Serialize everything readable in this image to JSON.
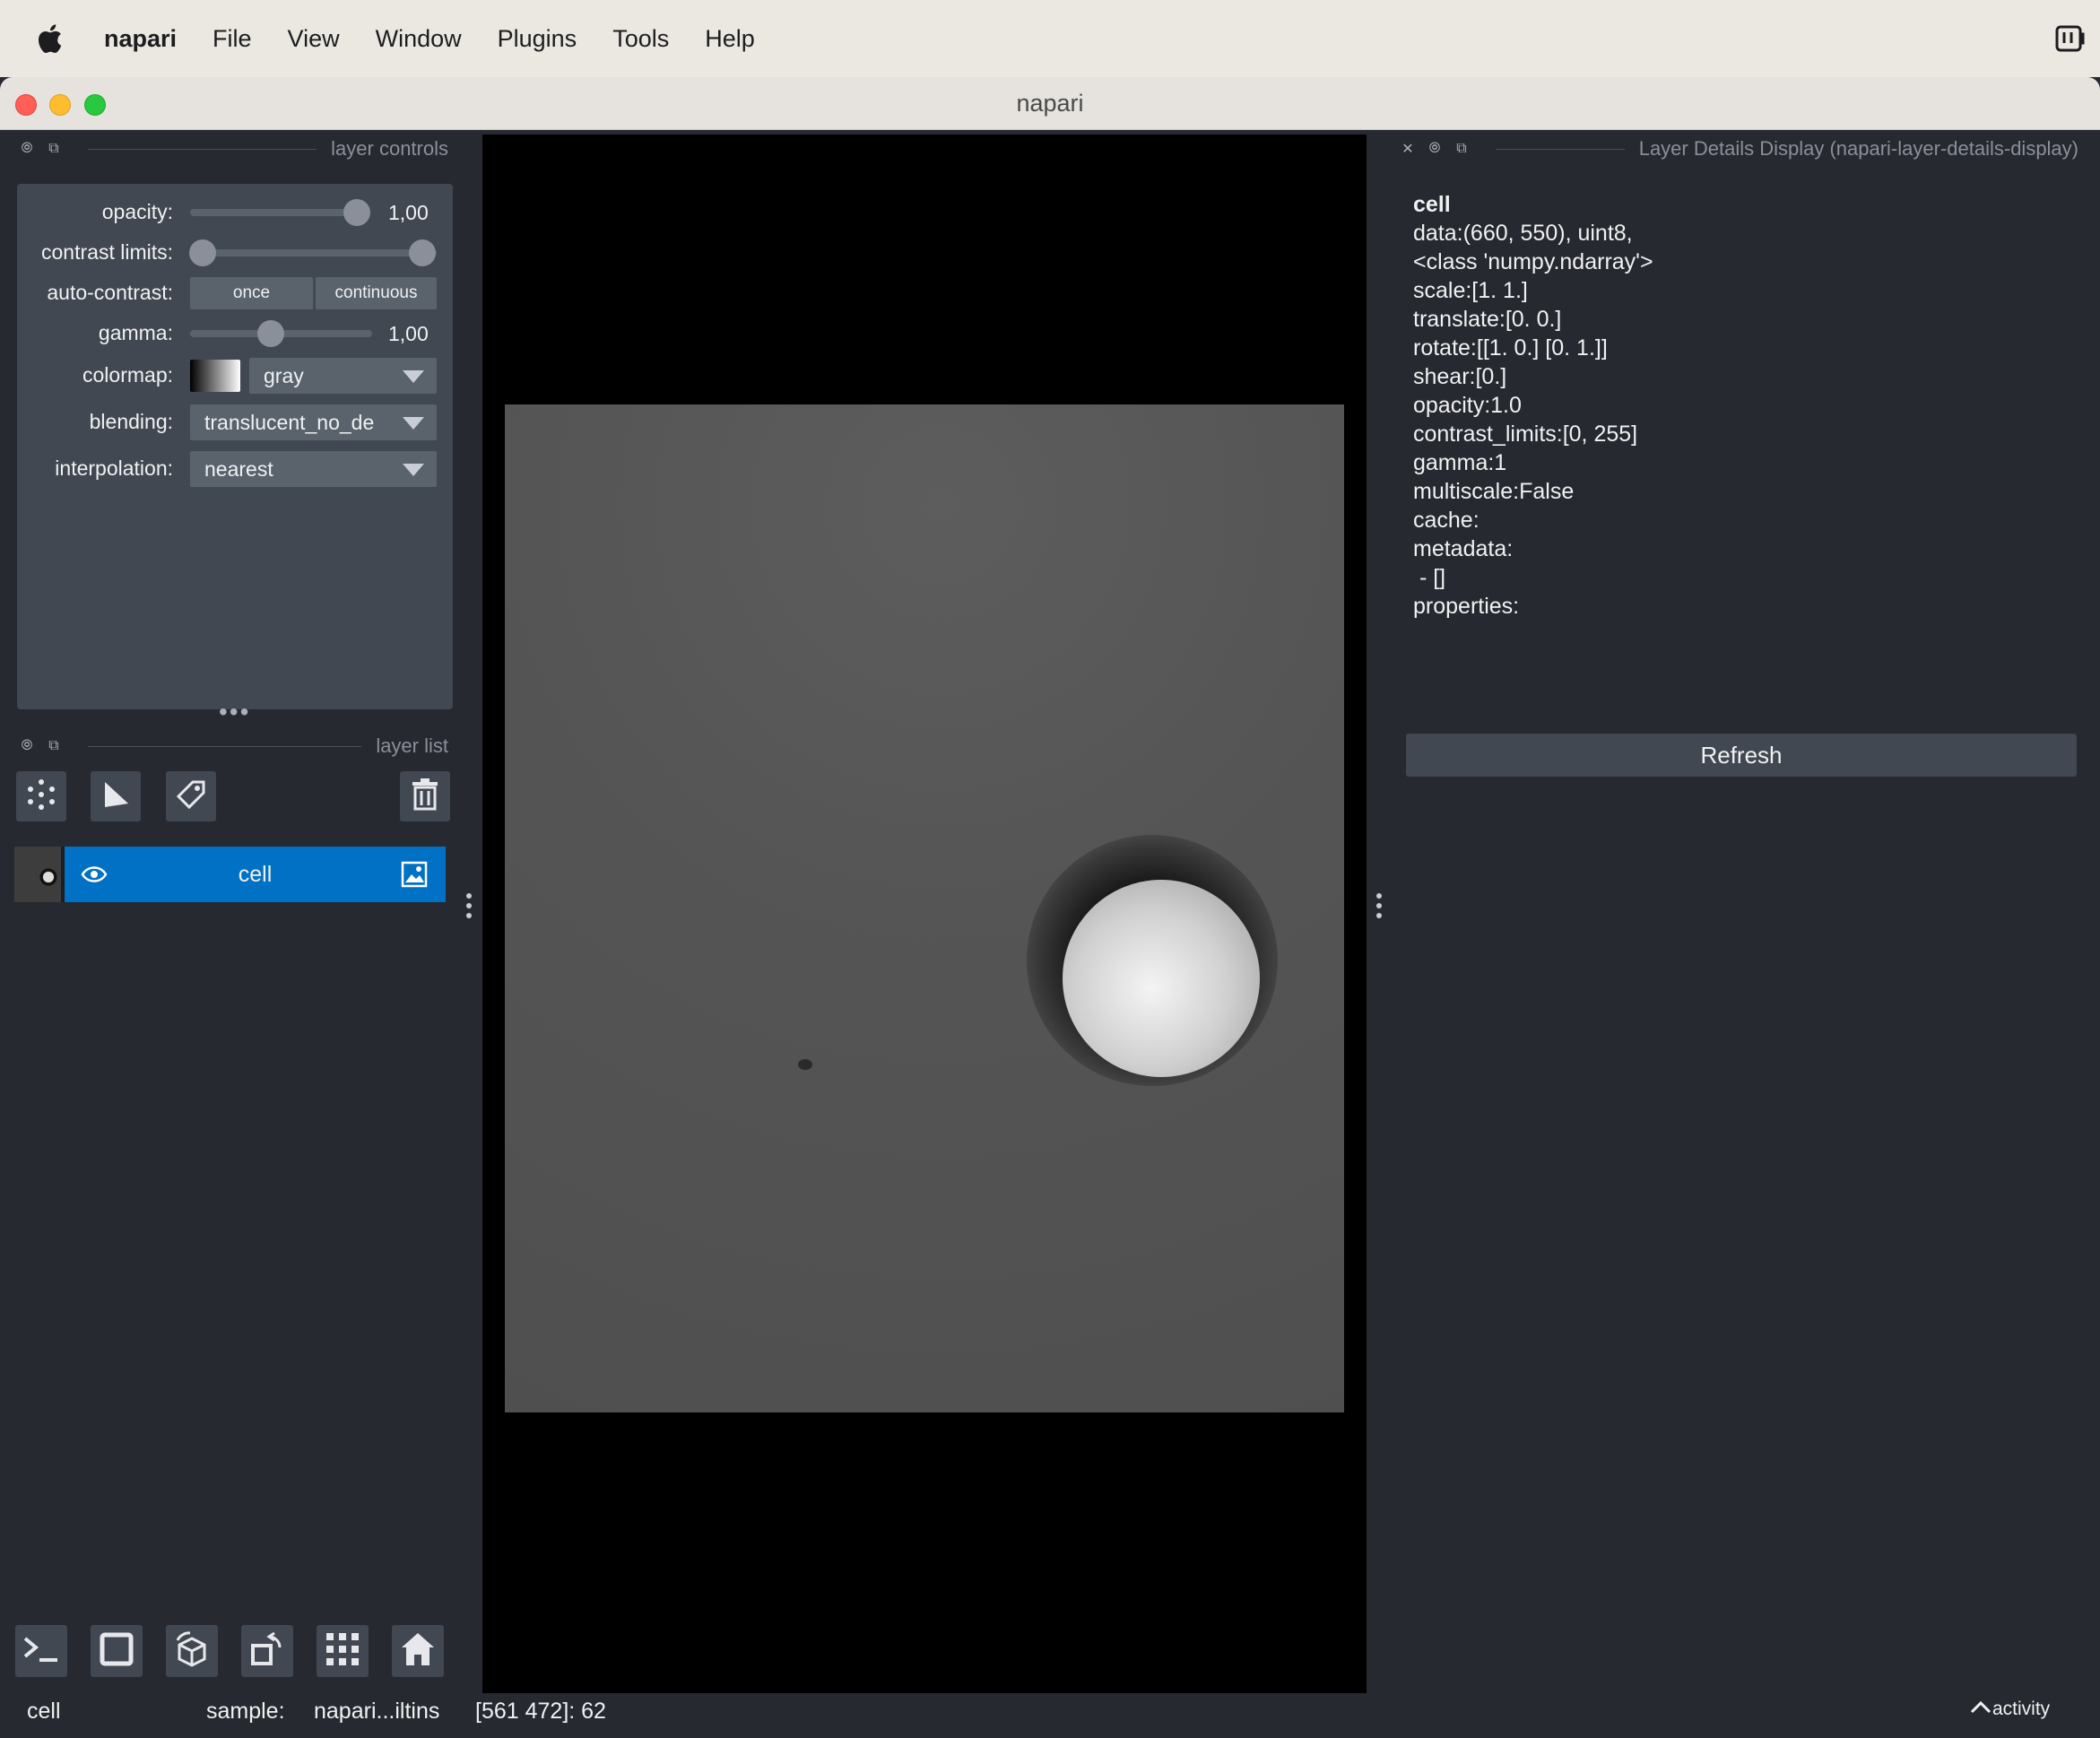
{
  "menubar": {
    "app_name": "napari",
    "items": [
      "File",
      "View",
      "Window",
      "Plugins",
      "Tools",
      "Help"
    ]
  },
  "window": {
    "title": "napari"
  },
  "layer_controls": {
    "header": "layer controls",
    "opacity_label": "opacity:",
    "opacity_value": "1,00",
    "opacity_level": 1.0,
    "contrast_label": "contrast limits:",
    "contrast_range": [
      0,
      255
    ],
    "auto_contrast_label": "auto-contrast:",
    "once_label": "once",
    "continuous_label": "continuous",
    "gamma_label": "gamma:",
    "gamma_value": "1,00",
    "colormap_label": "colormap:",
    "colormap_value": "gray",
    "blending_label": "blending:",
    "blending_value": "translucent_no_de",
    "interpolation_label": "interpolation:",
    "interpolation_value": "nearest"
  },
  "layer_list": {
    "header": "layer list",
    "tools": [
      "points-icon",
      "shapes-icon",
      "labels-icon",
      "delete-icon"
    ],
    "layers": [
      {
        "name": "cell",
        "visible": true,
        "selected": true
      }
    ]
  },
  "details_panel": {
    "header": "Layer Details Display (napari-layer-details-display)",
    "layer_name": "cell",
    "lines": [
      "data:(660, 550), uint8,",
      "<class 'numpy.ndarray'>",
      "scale:[1. 1.]",
      "translate:[0. 0.]",
      "rotate:[[1. 0.] [0. 1.]]",
      "shear:[0.]",
      "opacity:1.0",
      "contrast_limits:[0, 255]",
      "gamma:1",
      "multiscale:False",
      "cache:",
      "metadata:",
      " - []",
      "properties:"
    ],
    "refresh_label": "Refresh"
  },
  "bottom_toolbar": [
    "console-icon",
    "2d-3d-toggle-icon",
    "roll-dimensions-icon",
    "transpose-icon",
    "grid-icon",
    "home-icon"
  ],
  "status": {
    "layer": "cell",
    "sample_label": "sample:",
    "sample_value": "napari...iltins",
    "coords": "[561 472]: 62",
    "activity": "activity"
  }
}
